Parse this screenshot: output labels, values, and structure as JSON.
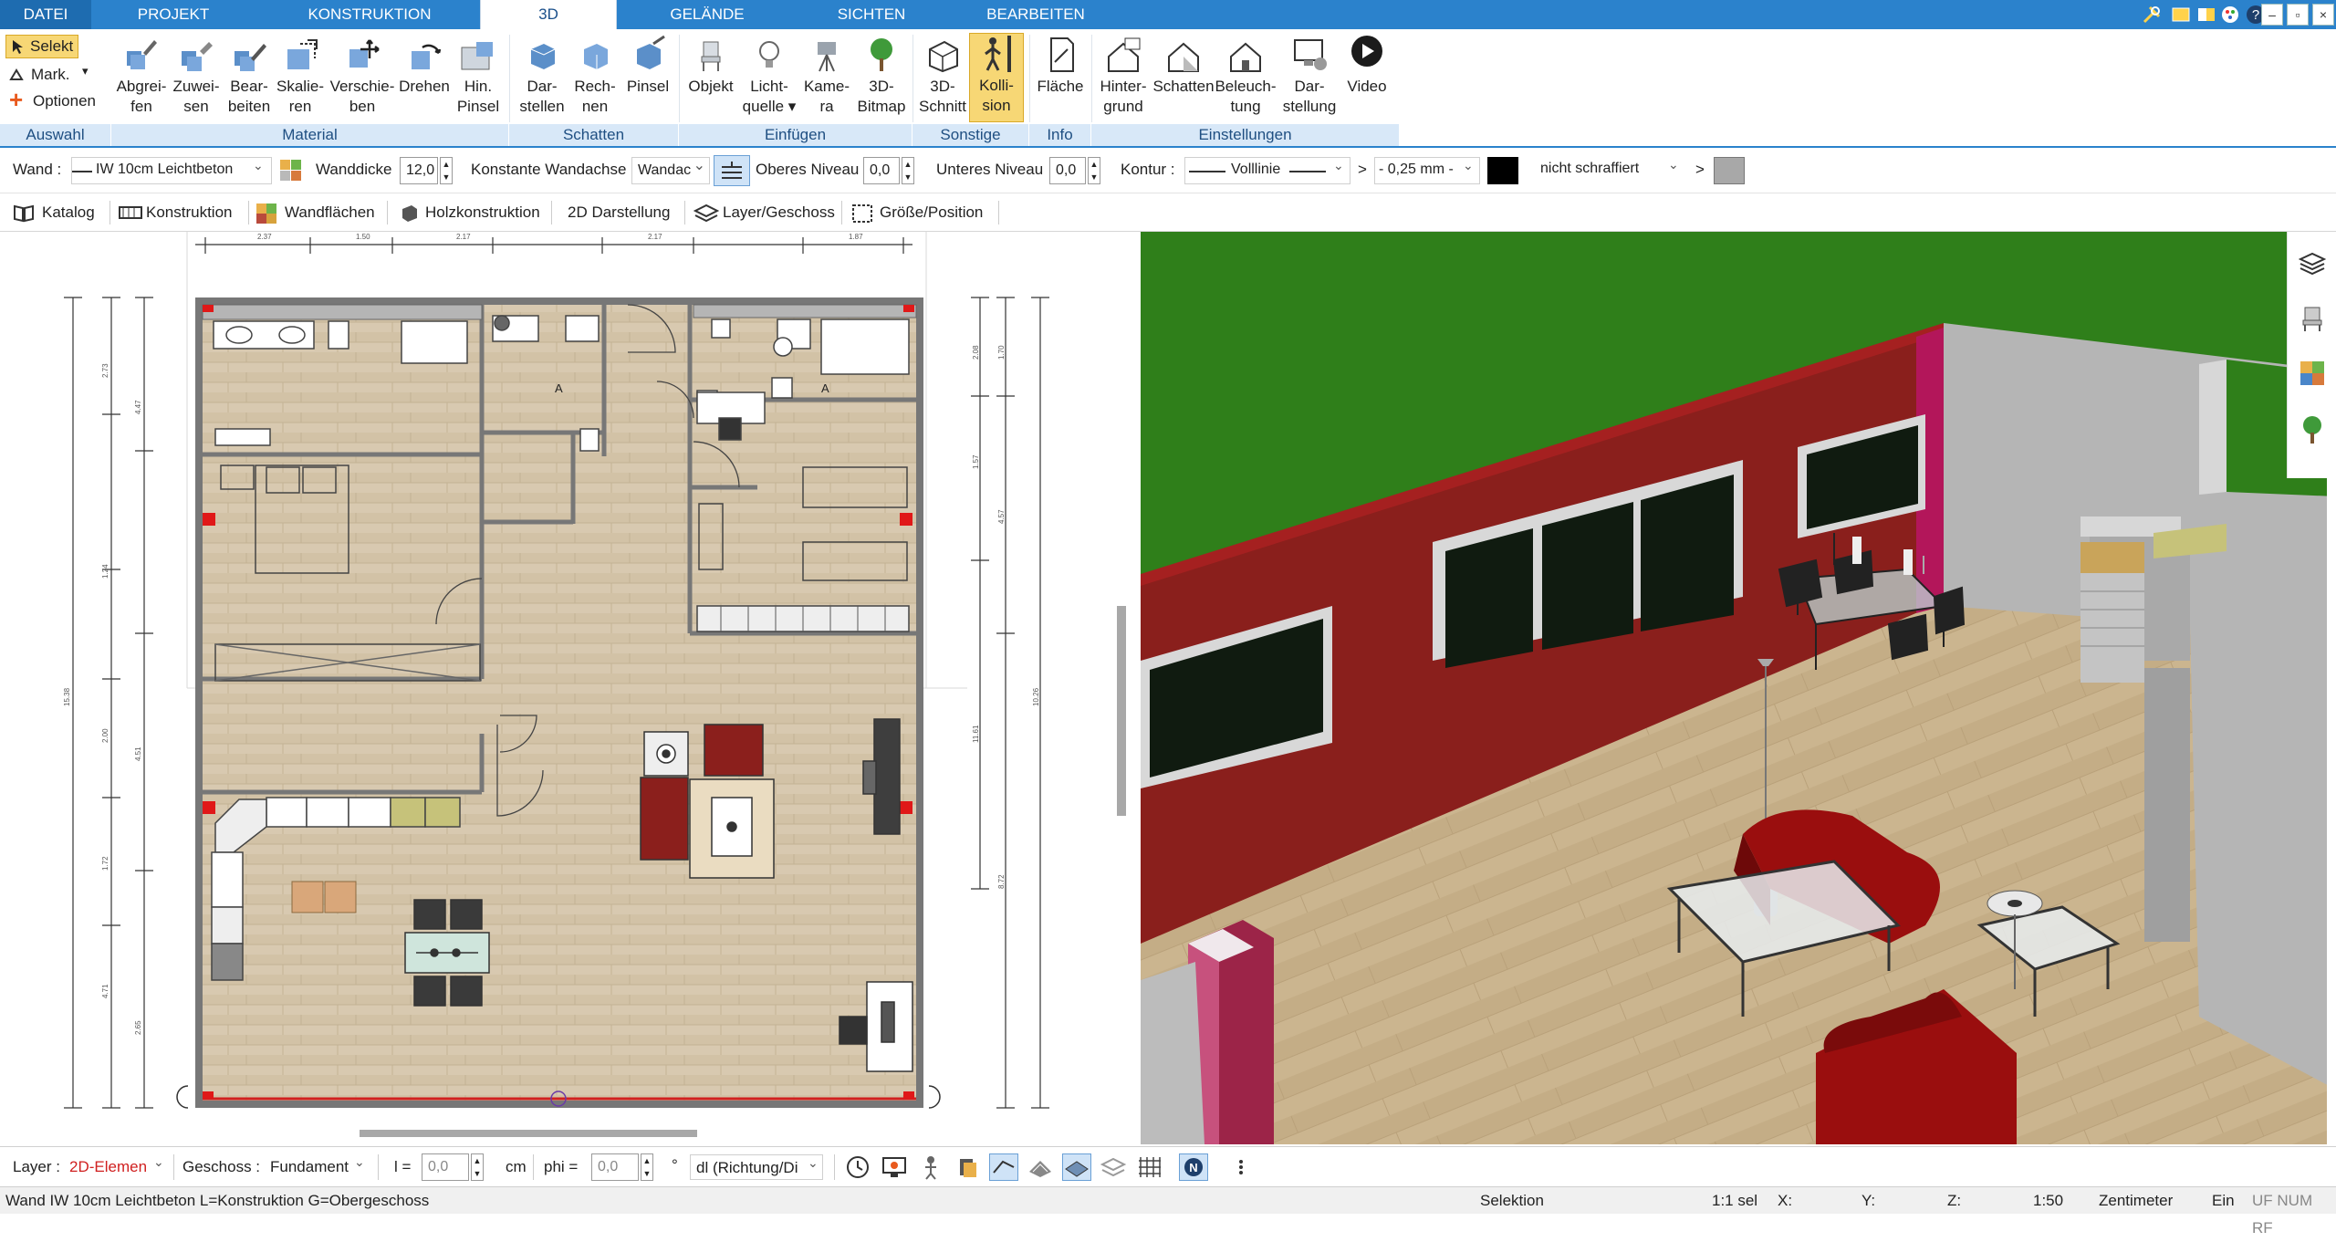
{
  "tabs": [
    "DATEI",
    "PROJEKT",
    "KONSTRUKTION",
    "3D",
    "GELÄNDE",
    "SICHTEN",
    "BEARBEITEN"
  ],
  "active_tab": "3D",
  "ribbon": {
    "auswahl": {
      "label": "Auswahl",
      "selekt": "Selekt",
      "mark": "Mark.",
      "optionen": "Optionen"
    },
    "material": {
      "label": "Material",
      "buttons": [
        {
          "l1": "Abgrei-",
          "l2": "fen",
          "icon": "eyedropper-icon"
        },
        {
          "l1": "Zuwei-",
          "l2": "sen",
          "icon": "assign-material-icon"
        },
        {
          "l1": "Bear-",
          "l2": "beiten",
          "icon": "edit-material-icon"
        },
        {
          "l1": "Skalie-",
          "l2": "ren",
          "icon": "scale-icon"
        },
        {
          "l1": "Verschie-",
          "l2": "ben",
          "icon": "move-icon"
        },
        {
          "l1": "Drehen",
          "l2": "",
          "icon": "rotate-icon"
        },
        {
          "l1": "Hin.",
          "l2": "Pinsel",
          "icon": "background-brush-icon"
        }
      ]
    },
    "schatten": {
      "label": "Schatten",
      "buttons": [
        {
          "l1": "Dar-",
          "l2": "stellen",
          "icon": "shadow-display-icon"
        },
        {
          "l1": "Rech-",
          "l2": "nen",
          "icon": "shadow-calc-icon"
        },
        {
          "l1": "Pinsel",
          "l2": "",
          "icon": "shadow-brush-icon"
        }
      ]
    },
    "einfuegen": {
      "label": "Einfügen",
      "buttons": [
        {
          "l1": "Objekt",
          "l2": "",
          "icon": "chair-icon"
        },
        {
          "l1": "Licht-",
          "l2": "quelle ▾",
          "icon": "lightbulb-icon"
        },
        {
          "l1": "Kame-",
          "l2": "ra",
          "icon": "camera-icon"
        },
        {
          "l1": "3D-",
          "l2": "Bitmap",
          "icon": "tree-icon"
        }
      ]
    },
    "sonstige": {
      "label": "Sonstige",
      "buttons": [
        {
          "l1": "3D-",
          "l2": "Schnitt",
          "icon": "section-icon"
        },
        {
          "l1": "Kolli-",
          "l2": "sion",
          "icon": "collision-person-icon"
        }
      ]
    },
    "info": {
      "label": "Info",
      "buttons": [
        {
          "l1": "Fläche",
          "l2": "",
          "icon": "area-icon"
        }
      ]
    },
    "einstellungen": {
      "label": "Einstellungen",
      "buttons": [
        {
          "l1": "Hinter-",
          "l2": "grund",
          "icon": "background-house-icon"
        },
        {
          "l1": "Schatten",
          "l2": "",
          "icon": "shadow-house-icon"
        },
        {
          "l1": "Beleuch-",
          "l2": "tung",
          "icon": "lighting-house-icon"
        },
        {
          "l1": "Dar-",
          "l2": "stellung",
          "icon": "display-settings-icon"
        },
        {
          "l1": "Video",
          "l2": "",
          "icon": "video-play-icon"
        }
      ]
    }
  },
  "props": {
    "wand_label": "Wand :",
    "wand_value": "IW 10cm Leichtbeton",
    "wanddicke_label": "Wanddicke",
    "wanddicke_value": "12,0",
    "achse_label": "Konstante Wandachse",
    "achse_value": "Wandac",
    "oberes_label": "Oberes Niveau",
    "oberes_value": "0,0",
    "unteres_label": "Unteres Niveau",
    "unteres_value": "0,0",
    "kontur_label": "Kontur :",
    "kontur_value": "Volllinie",
    "gt1": ">",
    "stroke_value": "- 0,25 mm -",
    "schraffur_value": "nicht schraffiert",
    "gt2": ">"
  },
  "catbar": [
    "Katalog",
    "Konstruktion",
    "Wandflächen",
    "Holzkonstruktion",
    "2D Darstellung",
    "Layer/Geschoss",
    "Größe/Position"
  ],
  "plan": {
    "dims_top": [
      "2.37",
      "1.50",
      "2.17",
      "2.17",
      "1.87"
    ],
    "dims_left": [
      "2.73",
      "4.47",
      "1.24",
      "2.00",
      "4.51",
      "1.72",
      "4.71",
      "2.65",
      "15.38"
    ],
    "dims_right": [
      "2.08",
      "1.70",
      "1.57",
      "4.57",
      "11.61",
      "8.72",
      "10.26"
    ],
    "door_mark_1": "A",
    "door_mark_2": "A"
  },
  "bottom": {
    "layer_label": "Layer :",
    "layer_value": "2D-Elemen",
    "geschoss_label": "Geschoss :",
    "geschoss_value": "Fundament",
    "l_label": "l =",
    "l_value": "0,0",
    "l_unit": "cm",
    "phi_label": "phi =",
    "phi_value": "0,0",
    "phi_unit": "°",
    "dl_value": "dl (Richtung/Di"
  },
  "status": {
    "desc": "Wand IW 10cm Leichtbeton L=Konstruktion G=Obergeschoss",
    "mode": "Selektion",
    "sel": "1:1 sel",
    "x": "X:",
    "y": "Y:",
    "z": "Z:",
    "scale": "1:50",
    "unit": "Zentimeter",
    "ein": "Ein",
    "flags": "UF NUM RF"
  },
  "colors": {
    "accent": "#2b82cc",
    "ribbon_group": "#d8e8f8",
    "selected_button": "#f7d775",
    "wall_red": "#8b1f1c",
    "floor": "#c8b28f"
  }
}
